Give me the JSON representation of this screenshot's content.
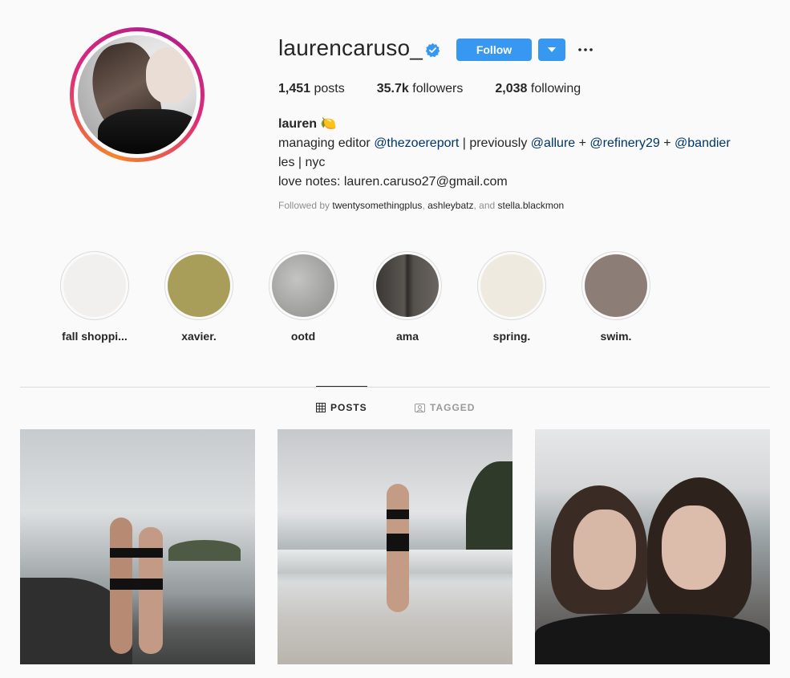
{
  "profile": {
    "username": "laurencaruso_",
    "follow_label": "Follow",
    "stats": [
      {
        "count": "1,451",
        "label": "posts"
      },
      {
        "count": "35.7k",
        "label": "followers"
      },
      {
        "count": "2,038",
        "label": "following"
      }
    ],
    "bio": {
      "name": "lauren 🍋",
      "line1_prefix": "managing editor ",
      "mention1": "@thezoereport",
      "line1_mid": " | previously ",
      "mention2": "@allure",
      "plus1": " + ",
      "mention3": "@refinery29",
      "plus2": " + ",
      "mention4": "@bandier",
      "line2": "les | nyc",
      "line3": "love notes: lauren.caruso27@gmail.com"
    },
    "followed_by": {
      "prefix": "Followed by ",
      "user1": "twentysomethingplus",
      "sep1": ", ",
      "user2": "ashleybatz",
      "sep2": ", and ",
      "user3": "stella.blackmon"
    }
  },
  "highlights": [
    {
      "label": "fall shoppi...",
      "color": "#f1f0ee"
    },
    {
      "label": "xavier.",
      "color": "#a99d5a"
    },
    {
      "label": "ootd",
      "color": "#a9a9a8"
    },
    {
      "label": "ama",
      "color": "#4a4743"
    },
    {
      "label": "spring.",
      "color": "#efeadf"
    },
    {
      "label": "swim.",
      "color": "#8c7e76"
    }
  ],
  "tabs": {
    "posts": "POSTS",
    "tagged": "TAGGED"
  },
  "colors": {
    "accent": "#3897f0",
    "mention": "#003569",
    "ring_start": "#f58529",
    "ring_end": "#dd2a7b"
  },
  "icons": {
    "verified": "verified-badge-icon",
    "dropdown": "chevron-down-icon",
    "more": "more-options-icon",
    "posts_tab": "grid-icon",
    "tagged_tab": "tagged-icon"
  }
}
